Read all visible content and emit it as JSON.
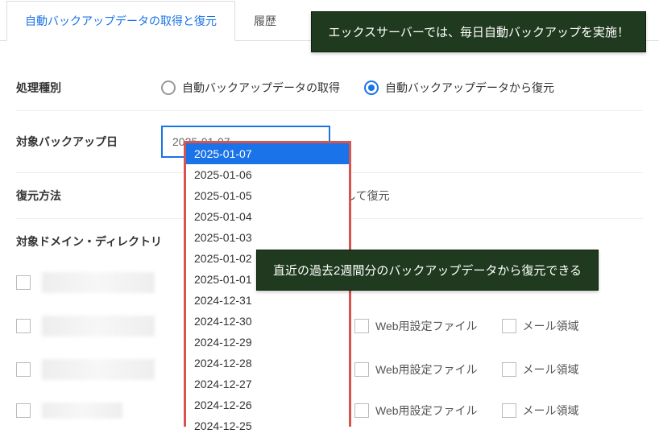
{
  "tabs": {
    "active": "自動バックアップデータの取得と復元",
    "history": "履歴"
  },
  "banner_top": "エックスサーバーでは、毎日自動バックアップを実施！",
  "banner_mid": "直近の過去2週間分のバックアップデータから復元できる",
  "rows": {
    "process_type_label": "処理種別",
    "radio_get": "自動バックアップデータの取得",
    "radio_restore": "自動バックアップデータから復元",
    "backup_date_label": "対象バックアップ日",
    "backup_date_value": "2025-01-07",
    "restore_method_label": "復元方法",
    "restore_method_suffix": "指定して復元",
    "domain_section_label": "対象ドメイン・ディレクトリ"
  },
  "dates": [
    "2025-01-07",
    "2025-01-06",
    "2025-01-05",
    "2025-01-04",
    "2025-01-03",
    "2025-01-02",
    "2025-01-01",
    "2024-12-31",
    "2024-12-30",
    "2024-12-29",
    "2024-12-28",
    "2024-12-27",
    "2024-12-26",
    "2024-12-25"
  ],
  "columns": {
    "web_config": "Web用設定ファイル",
    "mail": "メール領域"
  }
}
